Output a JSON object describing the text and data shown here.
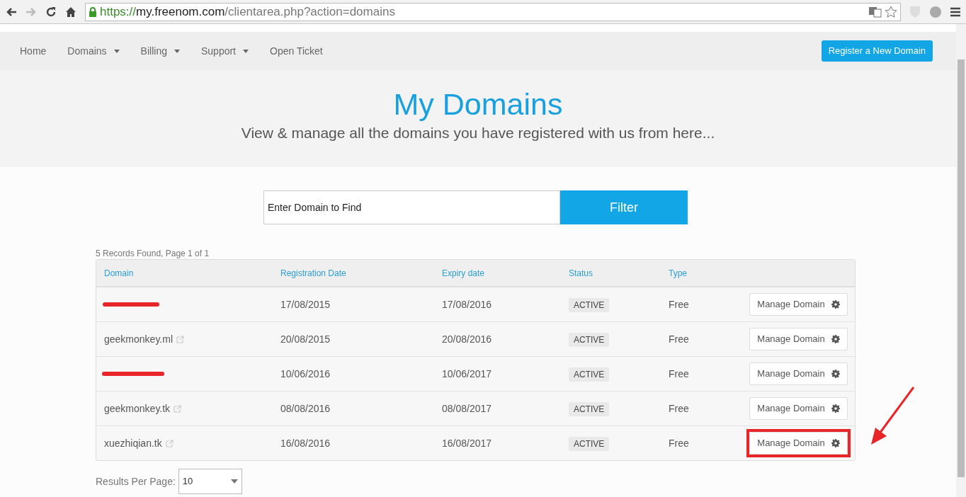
{
  "browser": {
    "url_scheme": "https://",
    "url_host": "my.freenom.com",
    "url_path": "/clientarea.php?action=domains"
  },
  "nav": {
    "items": [
      {
        "label": "Home",
        "dropdown": false
      },
      {
        "label": "Domains",
        "dropdown": true
      },
      {
        "label": "Billing",
        "dropdown": true
      },
      {
        "label": "Support",
        "dropdown": true
      },
      {
        "label": "Open Ticket",
        "dropdown": false
      }
    ],
    "register_button": "Register a New Domain"
  },
  "hero": {
    "title": "My Domains",
    "subtitle": "View & manage all the domains you have registered with us from here..."
  },
  "search": {
    "placeholder": "Enter Domain to Find",
    "button": "Filter"
  },
  "records_info": "5 Records Found, Page 1 of 1",
  "table": {
    "columns": [
      "Domain",
      "Registration Date",
      "Expiry date",
      "Status",
      "Type"
    ],
    "rows": [
      {
        "redacted": true,
        "registration_date": "17/08/2015",
        "expiry_date": "17/08/2016",
        "status": "ACTIVE",
        "type": "Free",
        "action": "Manage Domain",
        "highlighted": false
      },
      {
        "redacted": false,
        "domain": "geekmonkey.ml",
        "registration_date": "20/08/2015",
        "expiry_date": "20/08/2016",
        "status": "ACTIVE",
        "type": "Free",
        "action": "Manage Domain",
        "highlighted": false
      },
      {
        "redacted": true,
        "registration_date": "10/06/2016",
        "expiry_date": "10/06/2017",
        "status": "ACTIVE",
        "type": "Free",
        "action": "Manage Domain",
        "highlighted": false
      },
      {
        "redacted": false,
        "domain": "geekmonkey.tk",
        "registration_date": "08/08/2016",
        "expiry_date": "08/08/2017",
        "status": "ACTIVE",
        "type": "Free",
        "action": "Manage Domain",
        "highlighted": false
      },
      {
        "redacted": false,
        "domain": "xuezhiqian.tk",
        "registration_date": "16/08/2016",
        "expiry_date": "16/08/2017",
        "status": "ACTIVE",
        "type": "Free",
        "action": "Manage Domain",
        "highlighted": true
      }
    ]
  },
  "per_page": {
    "label": "Results Per Page:",
    "value": "10"
  }
}
